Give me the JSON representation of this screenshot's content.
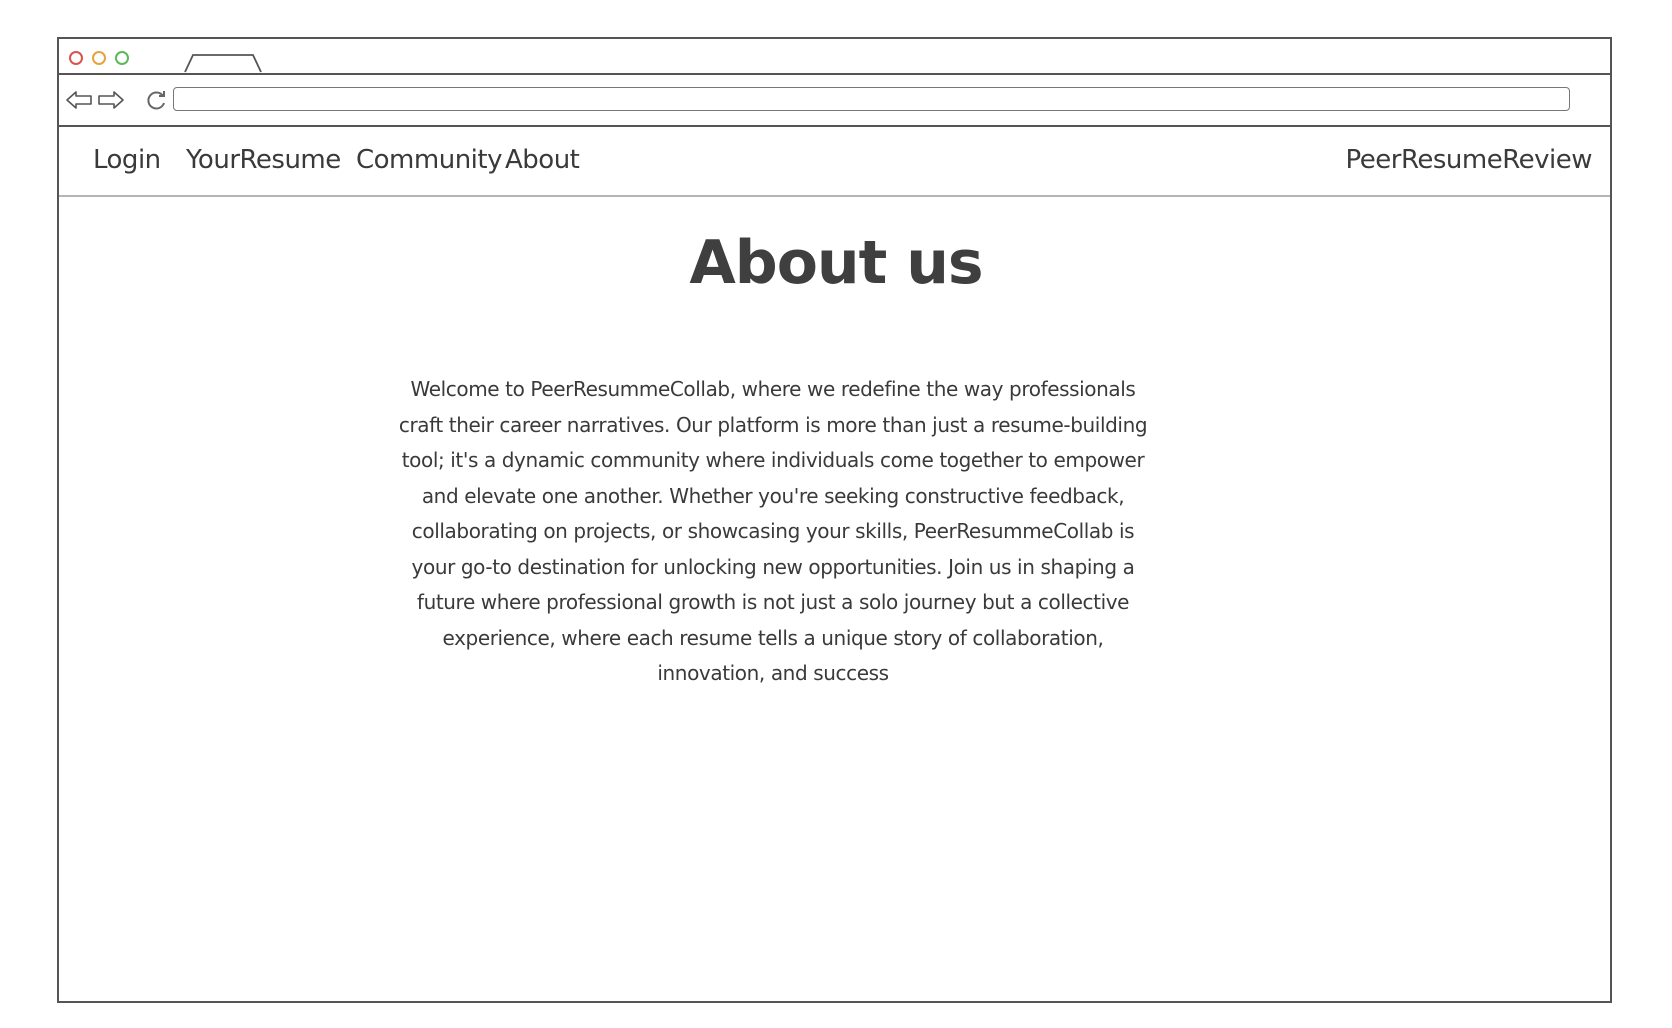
{
  "browser": {
    "url_value": ""
  },
  "navbar": {
    "links": [
      {
        "label": "Login"
      },
      {
        "label": "YourResume"
      },
      {
        "label": "Community"
      },
      {
        "label": "About"
      }
    ],
    "brand": "PeerResumeReview"
  },
  "main": {
    "title": "About us",
    "body": "Welcome to PeerResummeCollab, where we redefine the way professionals craft their career narratives. Our platform is more than just a resume-building tool; it's a dynamic community where individuals come together to empower and elevate one another. Whether you're seeking constructive feedback, collaborating on projects, or showcasing your skills, PeerResummeCollab is your go-to destination for unlocking new opportunities. Join us in shaping a future where professional growth is not just a solo journey but a collective experience, where each resume tells a unique story of collaboration, innovation, and success"
  },
  "icons": {
    "window_controls": [
      "close-dot",
      "minimize-dot",
      "maximize-dot"
    ],
    "nav": [
      "back-arrow-icon",
      "forward-arrow-icon",
      "reload-icon"
    ]
  },
  "colors": {
    "close_dot": "#d9534f",
    "minimize_dot": "#e6a23c",
    "maximize_dot": "#5cb85c",
    "frame": "#555555",
    "text": "#3a3a3a"
  }
}
